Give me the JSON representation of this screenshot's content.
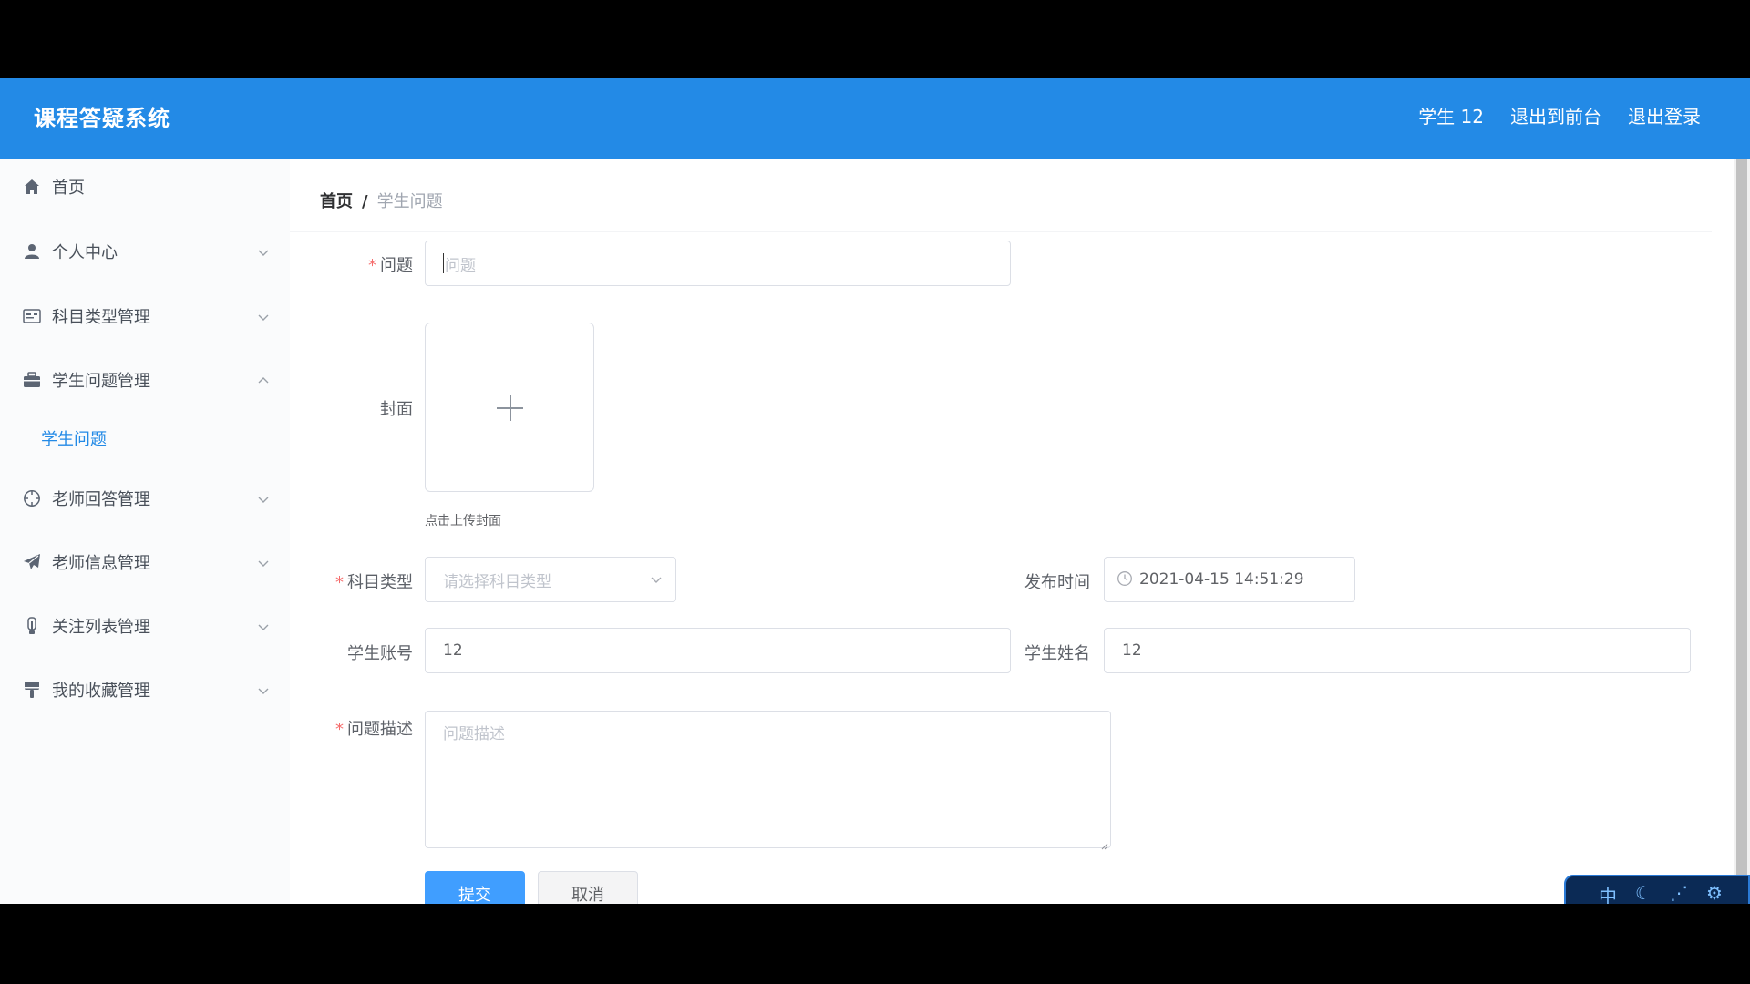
{
  "header": {
    "title": "课程答疑系统",
    "nav": [
      "学生 12",
      "退出到前台",
      "退出登录"
    ]
  },
  "sidebar": {
    "items": [
      {
        "label": "首页",
        "icon": "home-icon"
      },
      {
        "label": "个人中心",
        "icon": "user-icon"
      },
      {
        "label": "科目类型管理",
        "icon": "id-card-icon"
      },
      {
        "label": "学生问题管理",
        "icon": "briefcase-icon"
      },
      {
        "label": "老师回答管理",
        "icon": "compass-icon"
      },
      {
        "label": "老师信息管理",
        "icon": "paper-plane-icon"
      },
      {
        "label": "关注列表管理",
        "icon": "thermometer-icon"
      },
      {
        "label": "我的收藏管理",
        "icon": "brush-icon"
      }
    ],
    "submenu": [
      "学生问题"
    ]
  },
  "breadcrumb": {
    "home": "首页",
    "separator": "/",
    "current": "学生问题"
  },
  "form": {
    "question_label": "问题",
    "question_placeholder": "问题",
    "cover_label": "封面",
    "cover_tip": "点击上传封面",
    "subject_label": "科目类型",
    "subject_placeholder": "请选择科目类型",
    "publish_time_label": "发布时间",
    "publish_time_value": "2021-04-15 14:51:29",
    "student_account_label": "学生账号",
    "student_account_value": "12",
    "student_name_label": "学生姓名",
    "student_name_value": "12",
    "description_label": "问题描述",
    "description_placeholder": "问题描述"
  },
  "buttons": {
    "submit": "提交",
    "cancel": "取消"
  },
  "ime": {
    "mode": "中"
  },
  "colors": {
    "header": "#238ae6",
    "primary": "#409eff",
    "required": "#f56c6c"
  }
}
